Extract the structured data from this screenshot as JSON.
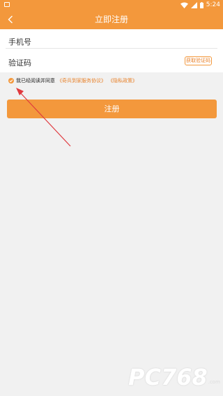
{
  "status_bar": {
    "time": "5:24",
    "icons": [
      "notification-icon",
      "wifi-icon",
      "signal-icon",
      "battery-icon"
    ]
  },
  "app_bar": {
    "title": "立即注册",
    "back_icon": "chevron-left-icon"
  },
  "form": {
    "phone": {
      "label": "手机号",
      "value": "",
      "placeholder": ""
    },
    "code": {
      "label": "验证码",
      "value": "",
      "placeholder": ""
    },
    "get_code_label": "获取验证码"
  },
  "agreement": {
    "checked": true,
    "text": "我已经阅读并同意",
    "service_link": "《奇兵到家服务协议》",
    "privacy_link": "《隐私政策》"
  },
  "submit_label": "注册",
  "watermark": {
    "brand": "PC768",
    "sub": ".com"
  },
  "colors": {
    "primary": "#f3983c",
    "link": "#e8822b",
    "background": "#f1f1f1",
    "arrow": "#e0393e"
  }
}
